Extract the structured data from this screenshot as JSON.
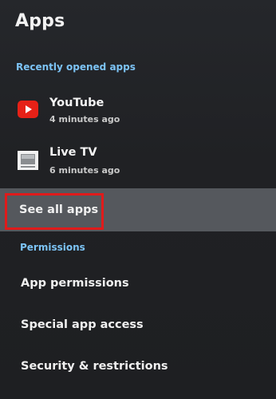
{
  "header": {
    "title": "Apps"
  },
  "recent": {
    "header": "Recently opened apps",
    "apps": [
      {
        "name": "YouTube",
        "subtitle": "4 minutes ago",
        "icon": "youtube-icon"
      },
      {
        "name": "Live TV",
        "subtitle": "6 minutes ago",
        "icon": "tv-icon"
      }
    ]
  },
  "see_all": {
    "label": "See all apps"
  },
  "permissions": {
    "header": "Permissions",
    "items": [
      {
        "label": "App permissions"
      },
      {
        "label": "Special app access"
      },
      {
        "label": "Security & restrictions"
      }
    ]
  },
  "colors": {
    "accent_header": "#7cc3f5",
    "focus_bg": "#55585d",
    "highlight": "#e01b1b",
    "youtube_red": "#e62117"
  }
}
